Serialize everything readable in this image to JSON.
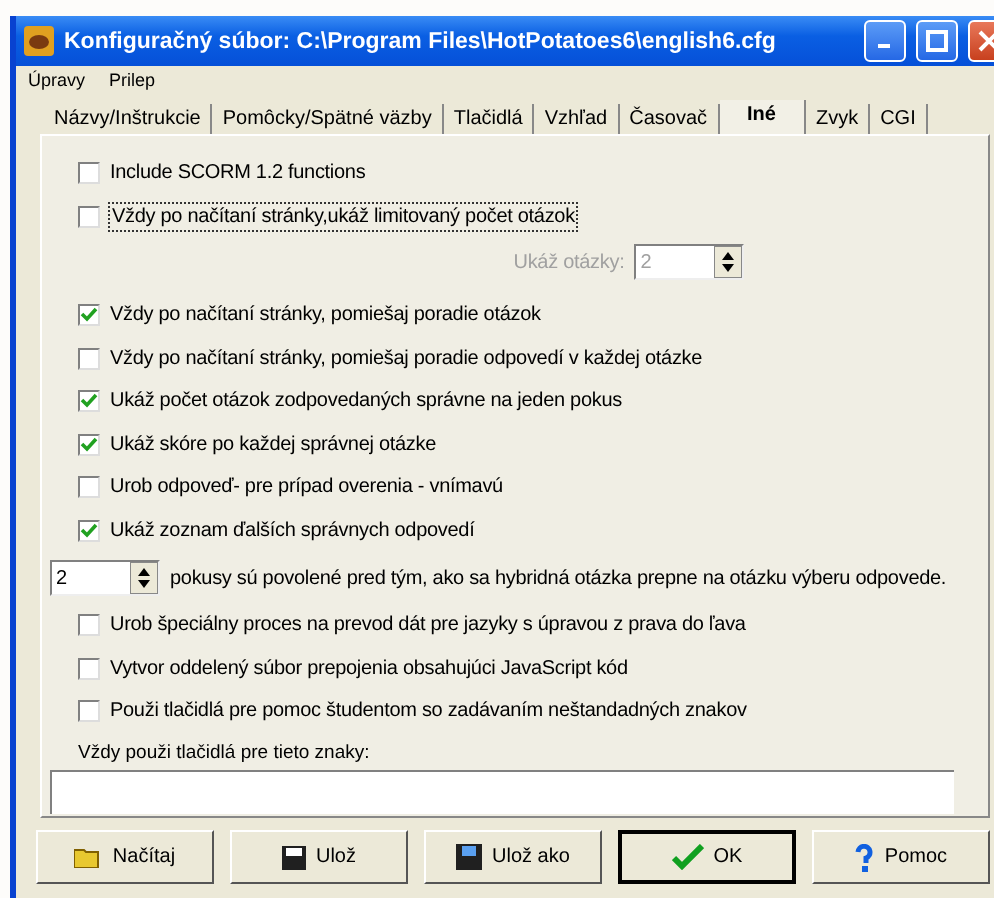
{
  "window": {
    "title": "Konfiguračný súbor: C:\\Program Files\\HotPotatoes6\\english6.cfg"
  },
  "menu": [
    "Úpravy",
    "Prilep"
  ],
  "tabs": [
    {
      "label": "Názvy/Inštrukcie",
      "selected": false
    },
    {
      "label": "Pomôcky/Spätné väzby",
      "selected": false
    },
    {
      "label": "Tlačidlá",
      "selected": false
    },
    {
      "label": "Vzhľad",
      "selected": false
    },
    {
      "label": "Časovač",
      "selected": false
    },
    {
      "label": "Iné",
      "selected": true
    },
    {
      "label": "Zvyk",
      "selected": false
    },
    {
      "label": "CGI",
      "selected": false
    }
  ],
  "options": [
    {
      "kind": "checkbox",
      "label": "Include SCORM 1.2 functions",
      "checked": false,
      "focused": false
    },
    {
      "kind": "checkbox",
      "label": "Vždy po načítaní stránky,ukáž limitovaný počet otázok",
      "checked": false,
      "focused": true
    },
    {
      "kind": "labeled_number",
      "label": "Ukáž otázky:",
      "value": "2",
      "disabled": true
    },
    {
      "kind": "checkbox",
      "label": "Vždy po načítaní stránky, pomiešaj poradie otázok",
      "checked": true,
      "focused": false
    },
    {
      "kind": "checkbox",
      "label": "Vždy po načítaní stránky, pomiešaj poradie odpovedí v každej otázke",
      "checked": false,
      "focused": false
    },
    {
      "kind": "checkbox",
      "label": "Ukáž počet otázok zodpovedaných správne na jeden pokus",
      "checked": true,
      "focused": false
    },
    {
      "kind": "checkbox",
      "label": "Ukáž skóre po každej správnej otázke",
      "checked": true,
      "focused": false
    },
    {
      "kind": "checkbox",
      "label": "Urob odpoveď- pre prípad overenia - vnímavú",
      "checked": false,
      "focused": false
    },
    {
      "kind": "checkbox",
      "label": "Ukáž zoznam ďalších správnych odpovedí",
      "checked": true,
      "focused": false
    },
    {
      "kind": "number_sentence",
      "value": "2",
      "label": "pokusy sú povolené pred tým, ako sa hybridná otázka prepne na otázku výberu odpovede.",
      "disabled": false
    },
    {
      "kind": "checkbox",
      "label": "Urob špeciálny proces na prevod dát pre jazyky s úpravou z prava do ľava",
      "checked": false,
      "focused": false
    },
    {
      "kind": "checkbox",
      "label": "Vytvor oddelený súbor prepojenia obsahujúci JavaScript kód",
      "checked": false,
      "focused": false
    },
    {
      "kind": "checkbox",
      "label": "Použi tlačidlá pre pomoc študentom so zadávaním neštandadných znakov",
      "checked": false,
      "focused": false
    }
  ],
  "chars_label": "Vždy použi tlačidlá pre tieto znaky:",
  "buttons": [
    {
      "label": "Načítaj",
      "kind": "folder",
      "default": false
    },
    {
      "label": "Ulož",
      "kind": "disk",
      "default": false
    },
    {
      "label": "Ulož ako",
      "kind": "disk_as",
      "default": false
    },
    {
      "label": "OK",
      "kind": "check",
      "default": true
    },
    {
      "label": "Pomoc",
      "kind": "help",
      "default": false
    }
  ]
}
